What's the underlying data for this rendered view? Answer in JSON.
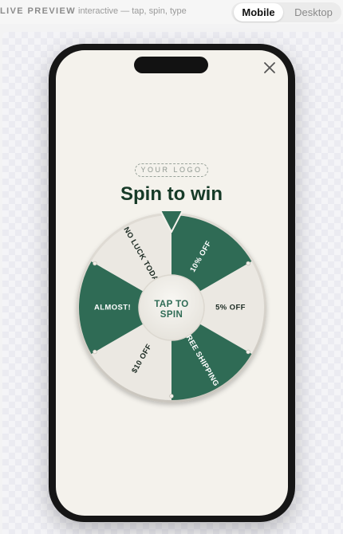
{
  "topbar": {
    "live_label": "LIVE PREVIEW",
    "subtitle": "interactive — tap, spin, type",
    "tabs": [
      {
        "label": "Mobile",
        "active": true
      },
      {
        "label": "Desktop",
        "active": false
      }
    ]
  },
  "popup": {
    "close_icon": "close-icon",
    "logo_placeholder": "YOUR LOGO",
    "headline": "Spin to win",
    "hub_line1": "TAP TO",
    "hub_line2": "SPIN",
    "segments": [
      {
        "label": "10% OFF",
        "style": "green"
      },
      {
        "label": "5% OFF",
        "style": "light"
      },
      {
        "label": "FREE SHIPPING",
        "style": "green"
      },
      {
        "label": "$10 OFF",
        "style": "light"
      },
      {
        "label": "ALMOST!",
        "style": "green"
      },
      {
        "label": "NO LUCK TODAY",
        "style": "light"
      }
    ]
  },
  "colors": {
    "green": "#2f6b55",
    "light": "#ebe8e2",
    "headline": "#163a27",
    "pointer": "#2f6b55",
    "text_on_green": "#ffffff",
    "text_on_light": "#1b2a22"
  }
}
